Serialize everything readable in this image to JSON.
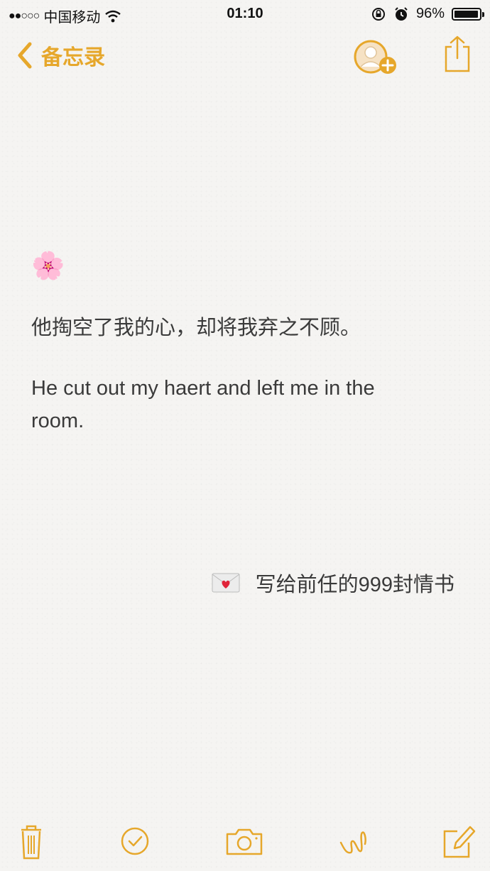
{
  "status_bar": {
    "signal": "●●○○○",
    "carrier": "中国移动",
    "time": "01:10",
    "battery_percent": "96%",
    "battery_level": 0.96
  },
  "nav": {
    "back_label": "备忘录"
  },
  "note": {
    "emoji": "🌸",
    "line_cn": "他掏空了我的心，却将我弃之不顾。",
    "line_en": "He cut out my haert and left me in the room."
  },
  "signature": {
    "text": "写给前任的999封情书"
  },
  "colors": {
    "accent": "#e6a72b",
    "background": "#f5f4f2",
    "text": "#3a3a3a"
  },
  "icons": {
    "back": "chevron-left-icon",
    "add_person": "add-person-icon",
    "share": "share-icon",
    "trash": "trash-icon",
    "checklist": "checkmark-circle-icon",
    "camera": "camera-icon",
    "sketch": "sketch-icon",
    "compose": "compose-icon"
  }
}
